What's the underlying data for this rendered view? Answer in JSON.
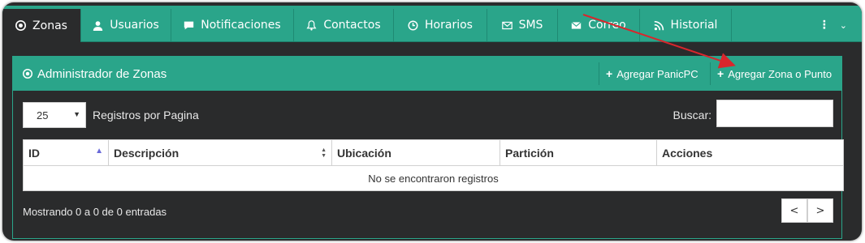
{
  "tabs": [
    {
      "label": "Zonas",
      "icon": "target-icon",
      "active": true
    },
    {
      "label": "Usuarios",
      "icon": "user-icon"
    },
    {
      "label": "Notificaciones",
      "icon": "comment-icon"
    },
    {
      "label": "Contactos",
      "icon": "bell-icon"
    },
    {
      "label": "Horarios",
      "icon": "clock-icon"
    },
    {
      "label": "SMS",
      "icon": "envelope-outline-icon"
    },
    {
      "label": "Correo",
      "icon": "envelope-icon"
    },
    {
      "label": "Historial",
      "icon": "rss-icon"
    }
  ],
  "panel": {
    "title": "Administrador de Zonas",
    "add_panic": "Agregar PanicPC",
    "add_zone": "Agregar Zona o Punto"
  },
  "controls": {
    "page_size": "25",
    "per_page_label": "Registros por Pagina",
    "search_label": "Buscar:",
    "search_value": ""
  },
  "table": {
    "columns": [
      "ID",
      "Descripción",
      "Ubicación",
      "Partición",
      "Acciones"
    ],
    "empty": "No se encontraron registros"
  },
  "footer": {
    "info": "Mostrando 0 a 0 de 0 entradas",
    "prev": "<",
    "next": ">"
  },
  "colors": {
    "accent": "#2aa58a",
    "background": "#2a2b2c",
    "arrow": "#d9262c"
  }
}
